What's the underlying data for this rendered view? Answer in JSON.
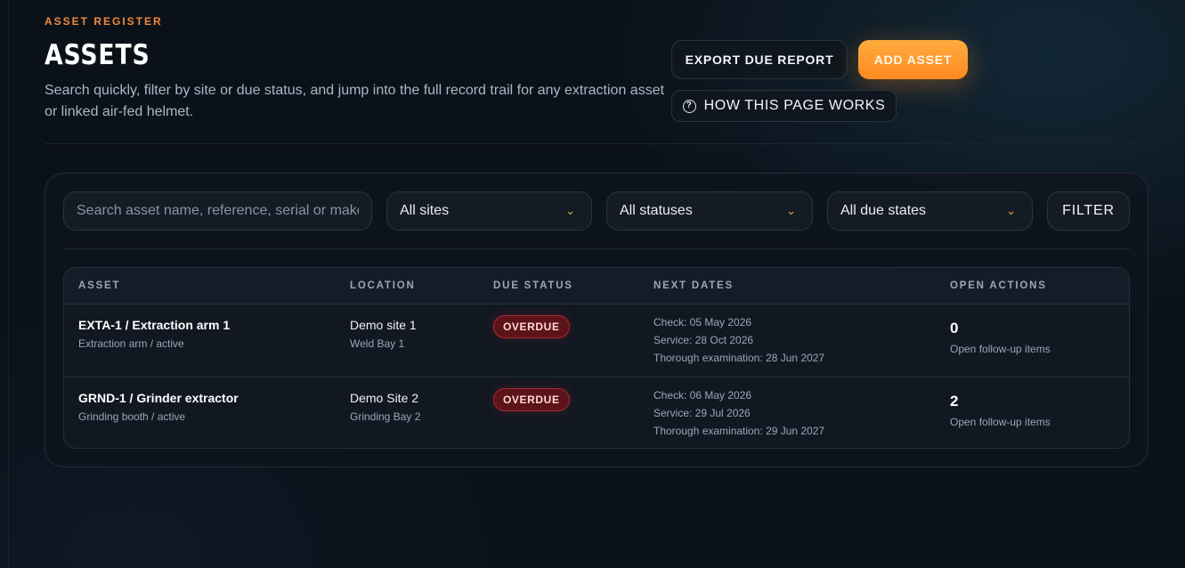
{
  "header": {
    "eyebrow": "ASSET REGISTER",
    "title": "ASSETS",
    "description": "Search quickly, filter by site or due status, and jump into the full record trail for any extraction asset or linked air-fed helmet."
  },
  "actions": {
    "export_label": "EXPORT DUE REPORT",
    "add_label": "ADD ASSET",
    "how_label": "HOW THIS PAGE WORKS",
    "how_icon": "question-circle-icon"
  },
  "filters": {
    "search_placeholder": "Search asset name, reference, serial or make",
    "search_value": "",
    "site": "All sites",
    "status": "All statuses",
    "due_state": "All due states",
    "filter_label": "FILTER"
  },
  "table": {
    "columns": [
      "ASSET",
      "LOCATION",
      "DUE STATUS",
      "NEXT DATES",
      "OPEN ACTIONS"
    ],
    "rows": [
      {
        "asset": "EXTA-1 / Extraction arm 1",
        "asset_sub": "Extraction arm / active",
        "location": "Demo site 1",
        "location_sub": "Weld Bay 1",
        "due_status": "OVERDUE",
        "check": "Check: 05 May 2026",
        "service": "Service: 28 Oct 2026",
        "exam": "Thorough examination: 28 Jun 2027",
        "open_count": "0",
        "open_label": "Open follow-up items"
      },
      {
        "asset": "GRND-1 / Grinder extractor",
        "asset_sub": "Grinding booth / active",
        "location": "Demo Site 2",
        "location_sub": "Grinding Bay 2",
        "due_status": "OVERDUE",
        "check": "Check: 06 May 2026",
        "service": "Service: 29 Jul 2026",
        "exam": "Thorough examination: 29 Jun 2027",
        "open_count": "2",
        "open_label": "Open follow-up items"
      }
    ]
  },
  "colors": {
    "accent": "#ff9a2e",
    "eyebrow": "#f08a3a",
    "overdue_bg": "#5c1419",
    "background": "#0b1119"
  }
}
